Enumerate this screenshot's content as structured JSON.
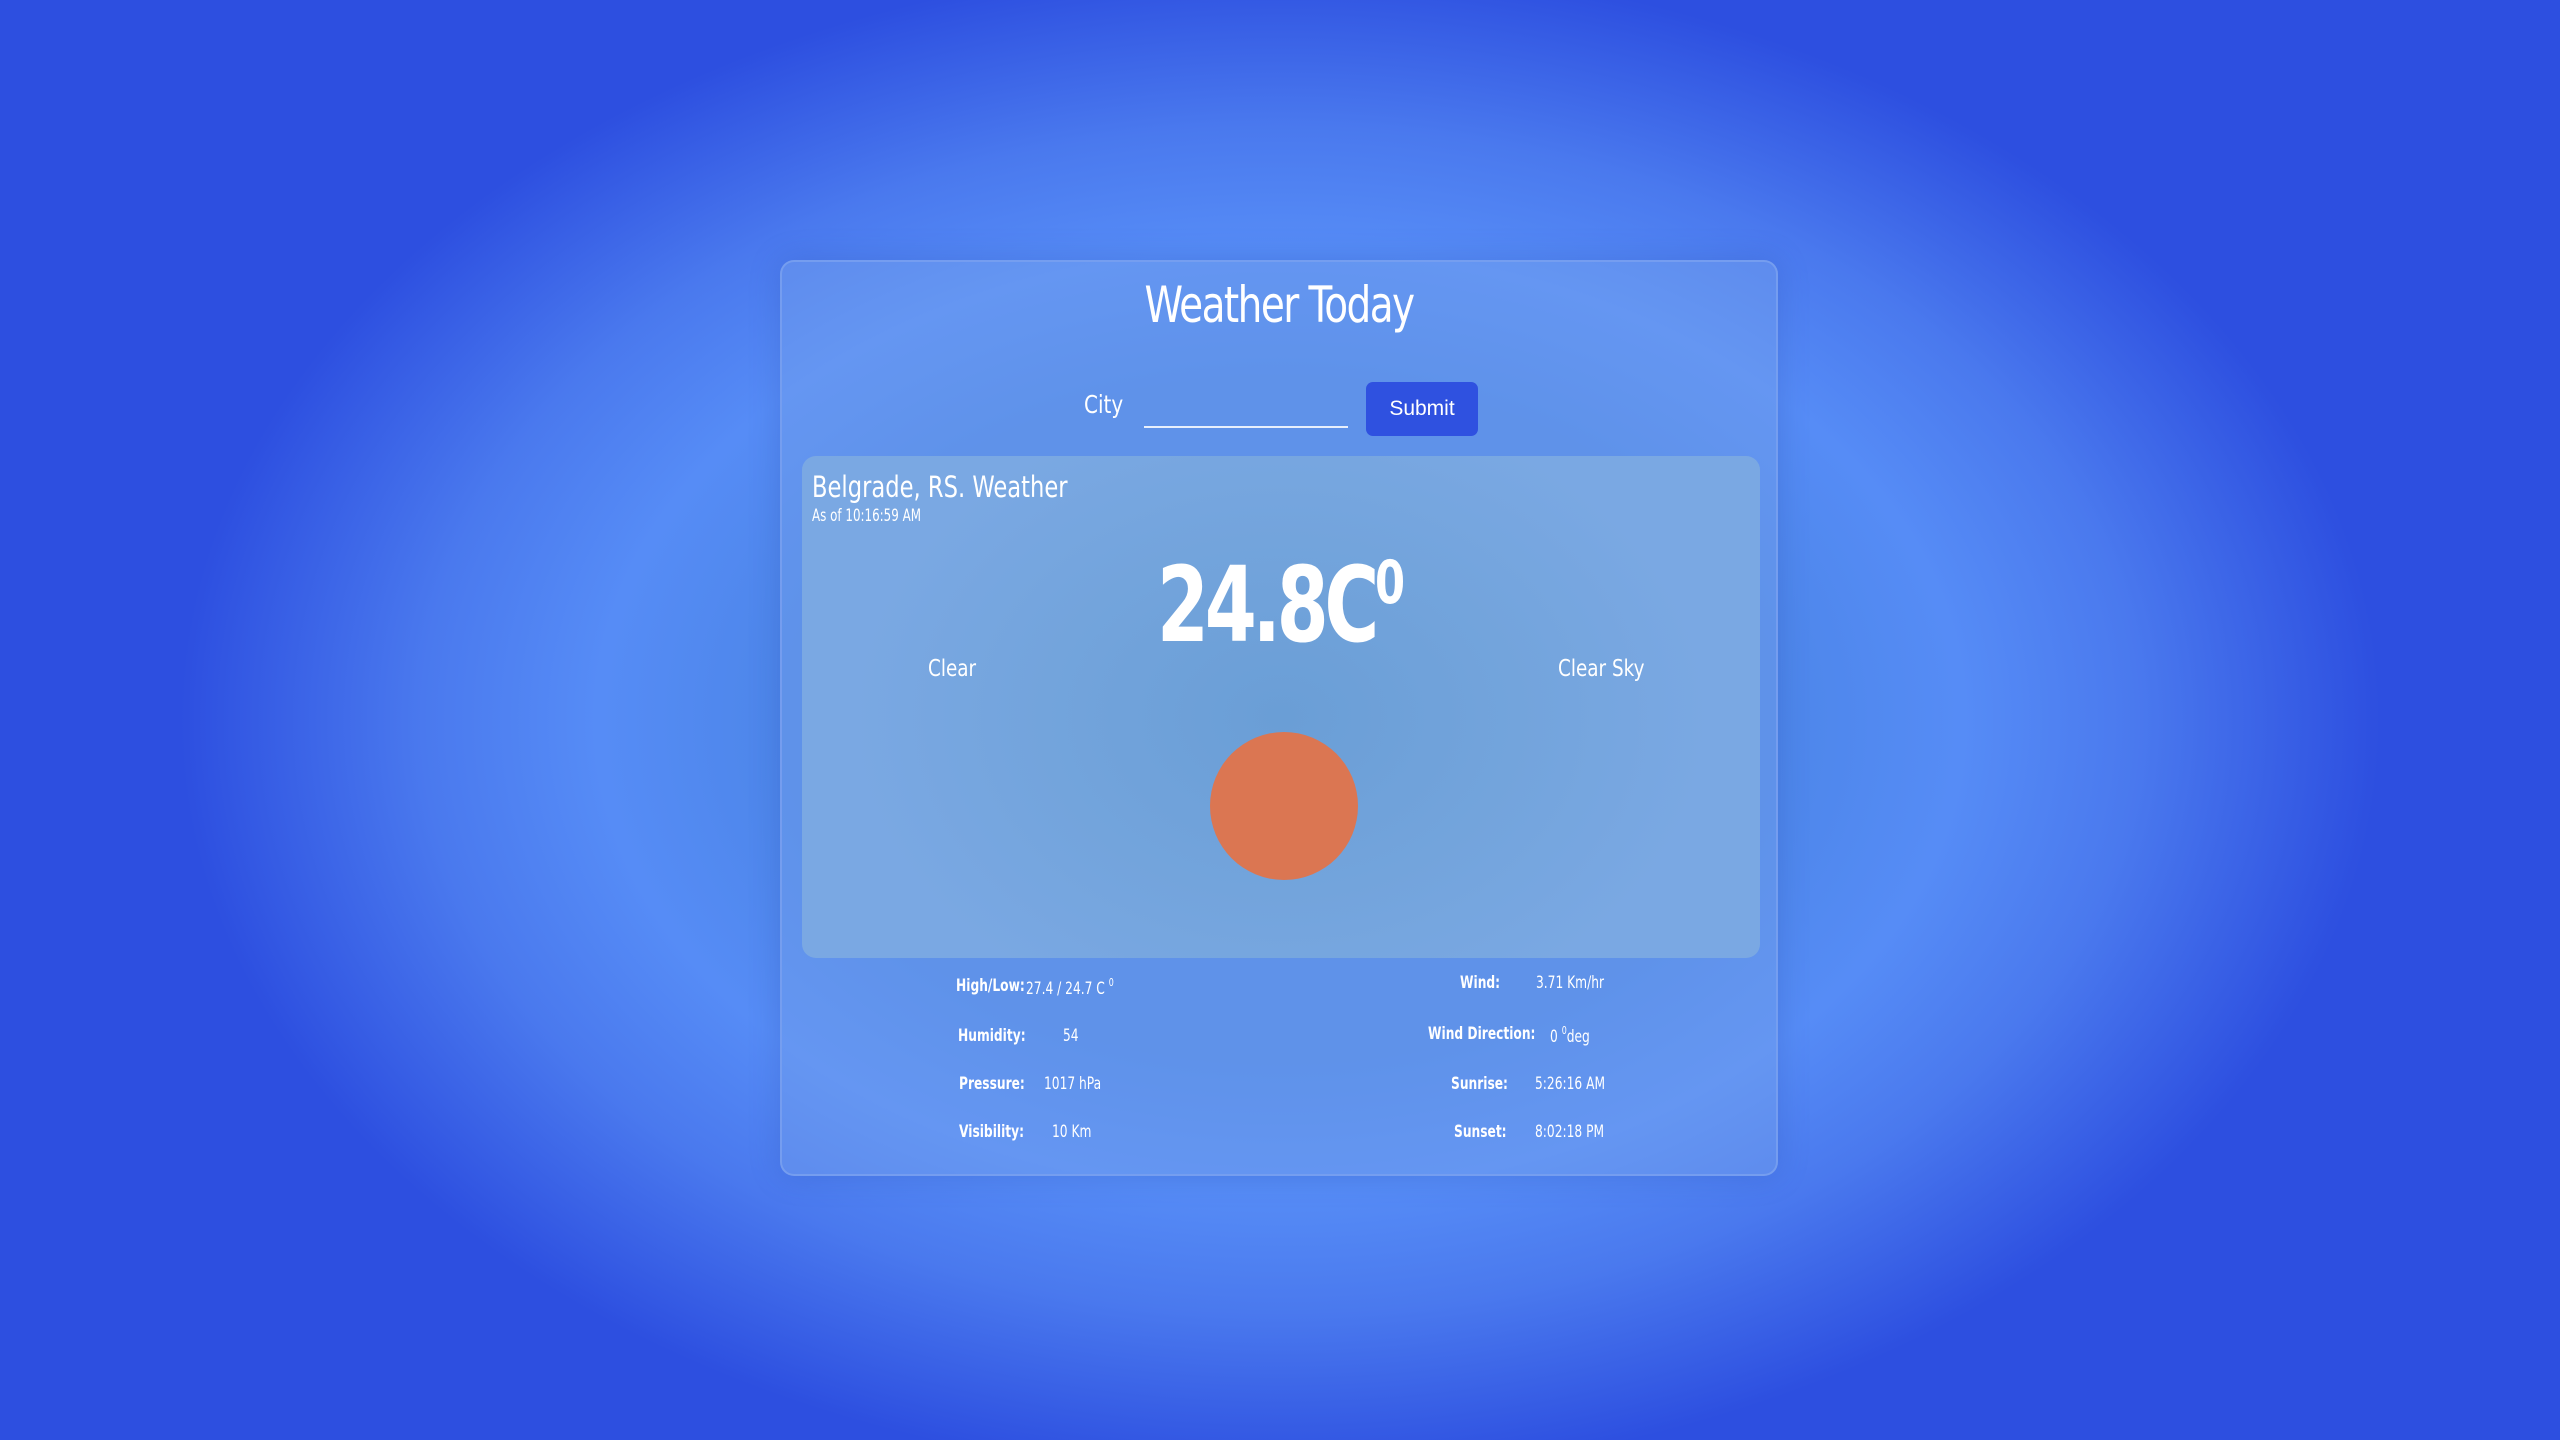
{
  "app": {
    "title": "Weather Today"
  },
  "search": {
    "label": "City",
    "value": "",
    "placeholder": "",
    "submit_label": "Submit"
  },
  "weather": {
    "location": "Belgrade, RS. Weather",
    "as_of": "As of 10:16:59 AM",
    "temperature": "24.8C",
    "temperature_unit_sup": "0",
    "main": "Clear",
    "description": "Clear Sky",
    "icon": "sun-icon",
    "sun_color": "#db7652"
  },
  "details": {
    "high_low": {
      "label": "High/Low:",
      "value": "27.4 / 24.7 C",
      "sup": "0"
    },
    "humidity": {
      "label": "Humidity:",
      "value": "54"
    },
    "pressure": {
      "label": "Pressure:",
      "value": "1017 hPa"
    },
    "visibility": {
      "label": "Visibility:",
      "value": "10 Km"
    },
    "wind": {
      "label": "Wind:",
      "value": "3.71 Km/hr"
    },
    "wind_direction": {
      "label": "Wind Direction:",
      "value_prefix": "0",
      "sup": "0",
      "value_suffix": "deg"
    },
    "sunrise": {
      "label": "Sunrise:",
      "value": "5:26:16 AM"
    },
    "sunset": {
      "label": "Sunset:",
      "value": "8:02:18 PM"
    }
  },
  "colors": {
    "accent": "#2f51e0",
    "background_edge": "#2d4fe0",
    "background_center": "#568cf6"
  }
}
